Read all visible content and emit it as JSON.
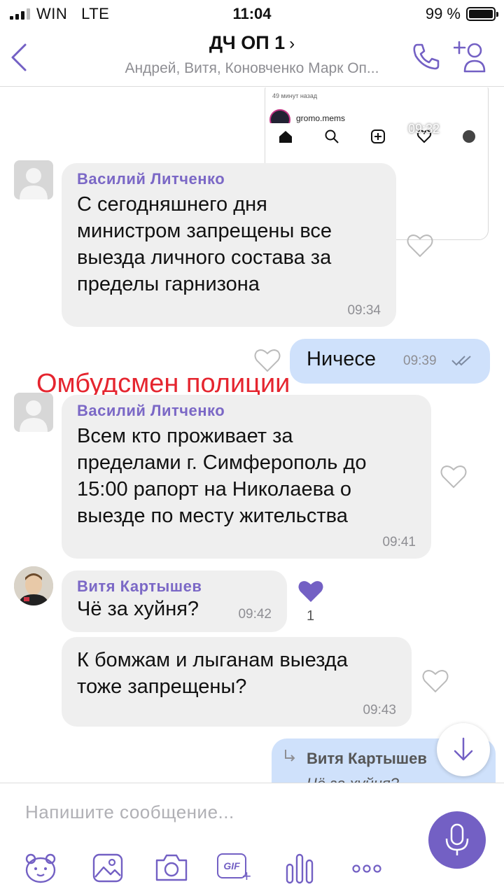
{
  "status_bar": {
    "carrier": "WIN",
    "network": "LTE",
    "time": "11:04",
    "battery_percent": "99 %"
  },
  "header": {
    "title": "ДЧ ОП 1",
    "title_chevron": "›",
    "subtitle": "Андрей, Витя, Коновченко Марк Оп...",
    "icons": [
      "back-chevron-icon",
      "phone-icon",
      "add-user-icon"
    ]
  },
  "media_preview": {
    "ago": "49 минут назад",
    "username": "gromo.mems",
    "time": "09:32"
  },
  "watermark": "Омбудсмен полиции",
  "messages": [
    {
      "sender": "Василий Литченко",
      "text": [
        "С сегодняшнего дня",
        "министром запрещены все",
        "выезда личного состава за",
        "пределы гарнизона"
      ],
      "time": "09:34"
    },
    {
      "outgoing": true,
      "text": "Ничесе",
      "time": "09:39"
    },
    {
      "sender": "Василий Литченко",
      "text": [
        "Всем кто проживает за",
        "пределами г. Симферополь до",
        "15:00 рапорт на Николаева о",
        "выезде по месту жительства"
      ],
      "time": "09:41"
    },
    {
      "sender": "Витя Картышев",
      "text": "Чё за хуйня?",
      "time": "09:42",
      "likes": "1"
    },
    {
      "text": [
        "К бомжам и лыганам выезда",
        "тоже запрещены?"
      ],
      "time": "09:43"
    },
    {
      "outgoing": true,
      "reply_to": "Витя Картышев",
      "reply_text": "Чё за хуйня?"
    }
  ],
  "composer": {
    "placeholder": "Напишите сообщение...",
    "tools": [
      "sticker-icon",
      "gallery-icon",
      "camera-icon",
      "gif-icon",
      "poll-icon",
      "more-icon"
    ],
    "gif_label": "GIF"
  },
  "colors": {
    "accent": "#7360c4",
    "incoming_bubble": "#efefef",
    "outgoing_bubble": "#cfe1fb",
    "watermark": "#e5252f"
  }
}
